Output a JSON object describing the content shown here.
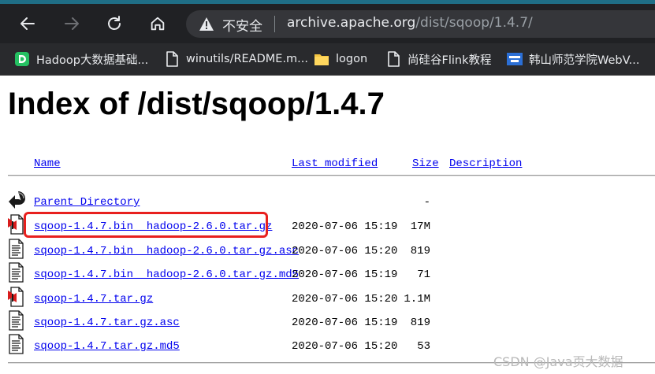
{
  "browser": {
    "address_bar": {
      "security_label": "不安全",
      "url_host": "archive.apache.org",
      "url_path": "/dist/sqoop/1.4.7/"
    },
    "bookmarks": [
      {
        "label": "Hadoop大数据基础...",
        "icon": "hadoop-leaf-icon"
      },
      {
        "label": "winutils/README.m...",
        "icon": "page-icon"
      },
      {
        "label": "logon",
        "icon": "folder-icon"
      },
      {
        "label": "尚硅谷Flink教程",
        "icon": "page-icon"
      },
      {
        "label": "韩山师范学院WebV...",
        "icon": "school-logo-icon"
      }
    ]
  },
  "page": {
    "title": "Index of /dist/sqoop/1.4.7",
    "columns": {
      "name": "Name",
      "last_modified": "Last modified",
      "size": "Size",
      "description": "Description"
    },
    "parent": {
      "name": "Parent Directory",
      "size": "-"
    },
    "files": [
      {
        "name": "sqoop-1.4.7.bin__hadoop-2.6.0.tar.gz",
        "date": "2020-07-06 15:19",
        "size": "17M",
        "icon": "archive-file-icon"
      },
      {
        "name": "sqoop-1.4.7.bin__hadoop-2.6.0.tar.gz.asc",
        "date": "2020-07-06 15:20",
        "size": "819",
        "icon": "text-file-icon"
      },
      {
        "name": "sqoop-1.4.7.bin__hadoop-2.6.0.tar.gz.md5",
        "date": "2020-07-06 15:19",
        "size": "71",
        "icon": "text-file-icon"
      },
      {
        "name": "sqoop-1.4.7.tar.gz",
        "date": "2020-07-06 15:20",
        "size": "1.1M",
        "icon": "archive-file-icon"
      },
      {
        "name": "sqoop-1.4.7.tar.gz.asc",
        "date": "2020-07-06 15:19",
        "size": "819",
        "icon": "text-file-icon"
      },
      {
        "name": "sqoop-1.4.7.tar.gz.md5",
        "date": "2020-07-06 15:20",
        "size": "53",
        "icon": "text-file-icon"
      }
    ]
  },
  "watermark": "CSDN @Java页大数据",
  "colors": {
    "link": "#0000ee",
    "highlight": "#e8201e",
    "toolbar": "#202124",
    "bookmarks_bar": "#292a2d"
  }
}
